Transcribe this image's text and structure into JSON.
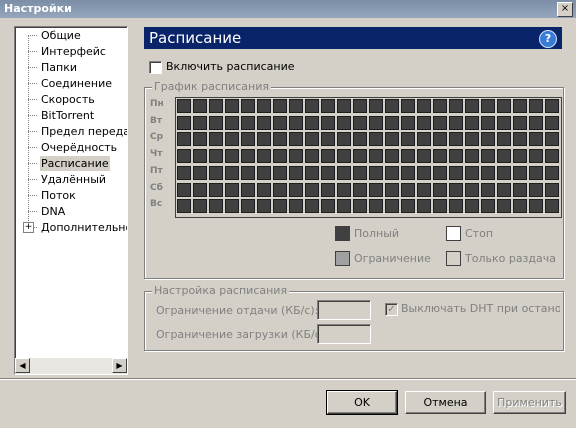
{
  "window": {
    "title": "Настройки",
    "close_label": "×"
  },
  "sidebar": {
    "items": [
      {
        "label": "Общие"
      },
      {
        "label": "Интерфейс"
      },
      {
        "label": "Папки"
      },
      {
        "label": "Соединение"
      },
      {
        "label": "Скорость"
      },
      {
        "label": "BitTorrent"
      },
      {
        "label": "Предел передачи"
      },
      {
        "label": "Очерёдность"
      },
      {
        "label": "Расписание",
        "selected": true
      },
      {
        "label": "Удалённый"
      },
      {
        "label": "Поток"
      },
      {
        "label": "DNA"
      },
      {
        "label": "Дополнительно",
        "expandable": true
      }
    ],
    "expander_symbol": "+",
    "scroll_left": "◀",
    "scroll_right": "▶"
  },
  "page": {
    "title": "Расписание",
    "help_icon": "?"
  },
  "enable_checkbox": {
    "label": "Включить расписание",
    "checked": false
  },
  "schedule_grid": {
    "legend": "График расписания",
    "days": [
      "Пн",
      "Вт",
      "Ср",
      "Чт",
      "Пт",
      "Сб",
      "Вс"
    ],
    "hours_count": 24,
    "cell_color": "#404040",
    "legend_items": [
      {
        "label": "Полный",
        "color": "#404040"
      },
      {
        "label": "Стоп",
        "color": "#ffffff"
      },
      {
        "label": "Ограничение",
        "color": "#a0a0a0"
      },
      {
        "label": "Только раздача",
        "color": "#d4d0c8"
      }
    ]
  },
  "schedule_settings": {
    "legend": "Настройка расписания",
    "upload_limit_label": "Ограничение отдачи (КБ/с):",
    "upload_limit_value": "",
    "download_limit_label": "Ограничение загрузки (КБ/с):",
    "download_limit_value": "",
    "disable_dht_label": "Выключать DHT при остановке",
    "disable_dht_checked": true,
    "check_mark": "✓"
  },
  "buttons": {
    "ok": "OK",
    "cancel": "Отмена",
    "apply": "Применить"
  },
  "colors": {
    "header_bg": "#0a246a",
    "dialog_bg": "#d4d0c8",
    "disabled_text": "#808080"
  }
}
